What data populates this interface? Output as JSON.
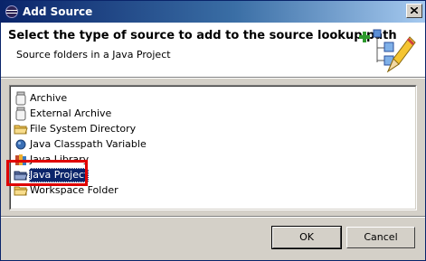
{
  "window": {
    "title": "Add Source"
  },
  "banner": {
    "title": "Select the type of source to add to the source lookup path",
    "description": "Source folders in a Java Project"
  },
  "source_types": [
    {
      "label": "Archive",
      "icon": "jar-icon"
    },
    {
      "label": "External Archive",
      "icon": "jar-icon"
    },
    {
      "label": "File System Directory",
      "icon": "folder-icon"
    },
    {
      "label": "Java Classpath Variable",
      "icon": "variable-icon"
    },
    {
      "label": "Java Library",
      "icon": "library-icon"
    },
    {
      "label": "Java Project",
      "icon": "project-icon",
      "selected": true
    },
    {
      "label": "Workspace Folder",
      "icon": "folder-icon"
    }
  ],
  "buttons": {
    "ok": "OK",
    "cancel": "Cancel"
  },
  "colors": {
    "selection": "#0a246a",
    "annotation": "#e00000",
    "titlebar": "#0a246a"
  }
}
